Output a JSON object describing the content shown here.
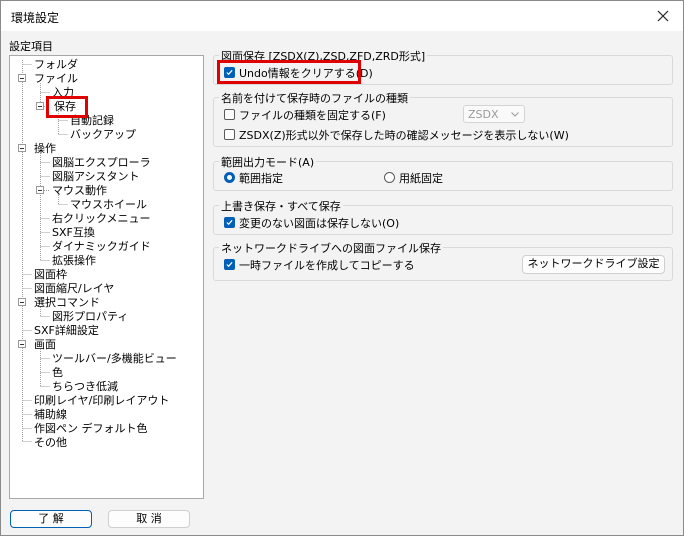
{
  "window": {
    "title": "環境設定"
  },
  "tree": {
    "label": "設定項目",
    "items": [
      {
        "label": "フォルダ"
      },
      {
        "label": "ファイル"
      },
      {
        "label": "入力"
      },
      {
        "label": "保存"
      },
      {
        "label": "自動記録"
      },
      {
        "label": "バックアップ"
      },
      {
        "label": "操作"
      },
      {
        "label": "図脳エクスプローラ"
      },
      {
        "label": "図脳アシスタント"
      },
      {
        "label": "マウス動作"
      },
      {
        "label": "マウスホイール"
      },
      {
        "label": "右クリックメニュー"
      },
      {
        "label": "SXF互換"
      },
      {
        "label": "ダイナミックガイド"
      },
      {
        "label": "拡張操作"
      },
      {
        "label": "図面枠"
      },
      {
        "label": "図面縮尺/レイヤ"
      },
      {
        "label": "選択コマンド"
      },
      {
        "label": "図形プロパティ"
      },
      {
        "label": "SXF詳細設定"
      },
      {
        "label": "画面"
      },
      {
        "label": "ツールバー/多機能ビュー"
      },
      {
        "label": "色"
      },
      {
        "label": "ちらつき低減"
      },
      {
        "label": "印刷レイヤ/印刷レイアウト"
      },
      {
        "label": "補助線"
      },
      {
        "label": "作図ペン デフォルト色"
      },
      {
        "label": "その他"
      }
    ]
  },
  "groups": {
    "save_format": {
      "title": "図面保存 [ZSDX(Z),ZSD,ZFD,ZRD形式]",
      "undo_clear": {
        "label": "Undo情報をクリアする(D)",
        "checked": true
      }
    },
    "named_save": {
      "title": "名前を付けて保存時のファイルの種類",
      "fix_type": {
        "label": "ファイルの種類を固定する(F)",
        "checked": false
      },
      "type_select": {
        "value": "ZSDX"
      },
      "confirm_msg": {
        "label": "ZSDX(Z)形式以外で保存した時の確認メッセージを表示しない(W)",
        "checked": false
      }
    },
    "range_output": {
      "title": "範囲出力モード(A)",
      "opt_range": {
        "label": "範囲指定",
        "checked": true
      },
      "opt_paper": {
        "label": "用紙固定",
        "checked": false
      }
    },
    "overwrite": {
      "title": "上書き保存・すべて保存",
      "no_change": {
        "label": "変更のない図面は保存しない(O)",
        "checked": true
      }
    },
    "network": {
      "title": "ネットワークドライブへの図面ファイル保存",
      "temp_copy": {
        "label": "一時ファイルを作成してコピーする",
        "checked": true
      },
      "settings_button": "ネットワークドライブ設定"
    }
  },
  "buttons": {
    "ok": "了 解",
    "cancel": "取 消"
  },
  "colors": {
    "accent": "#005fb8",
    "highlight": "#e00000"
  }
}
